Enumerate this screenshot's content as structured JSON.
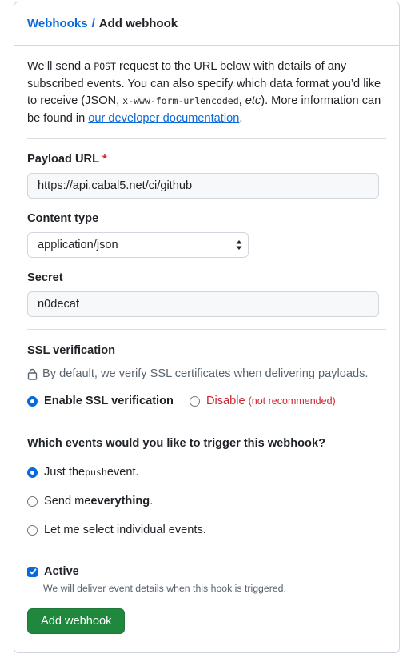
{
  "breadcrumb": {
    "parent": "Webhooks",
    "separator": "/",
    "current": "Add webhook"
  },
  "intro": {
    "p1": "We’ll send a ",
    "post": "POST",
    "p2": " request to the URL below with details of any subscribed events. You can also specify which data format you’d like to receive (JSON, ",
    "form": "x-www-form-urlencoded",
    "p3": ", ",
    "etc": "etc",
    "p4": "). More information can be found in ",
    "link": "our developer documentation",
    "p5": "."
  },
  "payload": {
    "label": "Payload URL",
    "required_mark": "*",
    "value": "https://api.cabal5.net/ci/github"
  },
  "content_type": {
    "label": "Content type",
    "value": "application/json"
  },
  "secret": {
    "label": "Secret",
    "value": "n0decaf"
  },
  "ssl": {
    "heading": "SSL verification",
    "hint": "By default, we verify SSL certificates when delivering payloads.",
    "enable_label": "Enable SSL verification",
    "disable_label": "Disable",
    "disable_note": "(not recommended)",
    "selected": "enable"
  },
  "events": {
    "heading": "Which events would you like to trigger this webhook?",
    "opt1_a": "Just the ",
    "opt1_code": "push",
    "opt1_b": " event.",
    "opt2_a": "Send me ",
    "opt2_bold": "everything",
    "opt2_b": ".",
    "opt3": "Let me select individual events.",
    "selected": "push"
  },
  "active": {
    "label": "Active",
    "checked": true,
    "hint": "We will deliver event details when this hook is triggered."
  },
  "submit": {
    "label": "Add webhook"
  },
  "colors": {
    "link": "#0969da",
    "primary_button": "#1f883d",
    "danger": "#cf222e",
    "border": "#d0d7de"
  }
}
